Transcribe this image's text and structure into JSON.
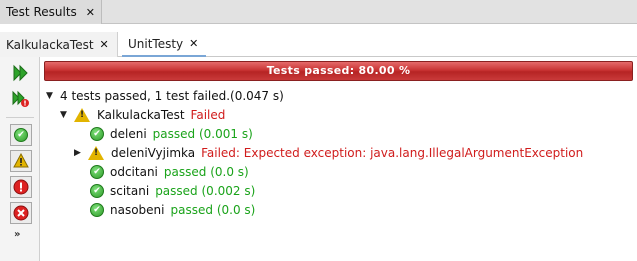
{
  "window_tab": {
    "label": "Test Results",
    "close": "✕"
  },
  "tabs": [
    {
      "label": "KalkulackaTest",
      "close": "✕"
    },
    {
      "label": "UnitTesty",
      "close": "✕"
    }
  ],
  "toolbar": {
    "more_label": "»"
  },
  "progress": {
    "text": "Tests passed: 80.00 %",
    "fraction": 0.8,
    "color": "#c93434"
  },
  "summary": "4 tests passed, 1 test failed.(0.047 s)",
  "suite": {
    "name": "KalkulackaTest",
    "status": "Failed"
  },
  "tests": [
    {
      "name": "deleni",
      "status": "passed",
      "time": "(0.001 s)"
    },
    {
      "name": "deleniVyjimka",
      "status": "Failed: Expected exception: java.lang.IllegalArgumentException",
      "time": ""
    },
    {
      "name": "odcitani",
      "status": "passed",
      "time": "(0.0 s)"
    },
    {
      "name": "scitani",
      "status": "passed",
      "time": "(0.002 s)"
    },
    {
      "name": "nasobeni",
      "status": "passed",
      "time": "(0.0 s)"
    }
  ]
}
